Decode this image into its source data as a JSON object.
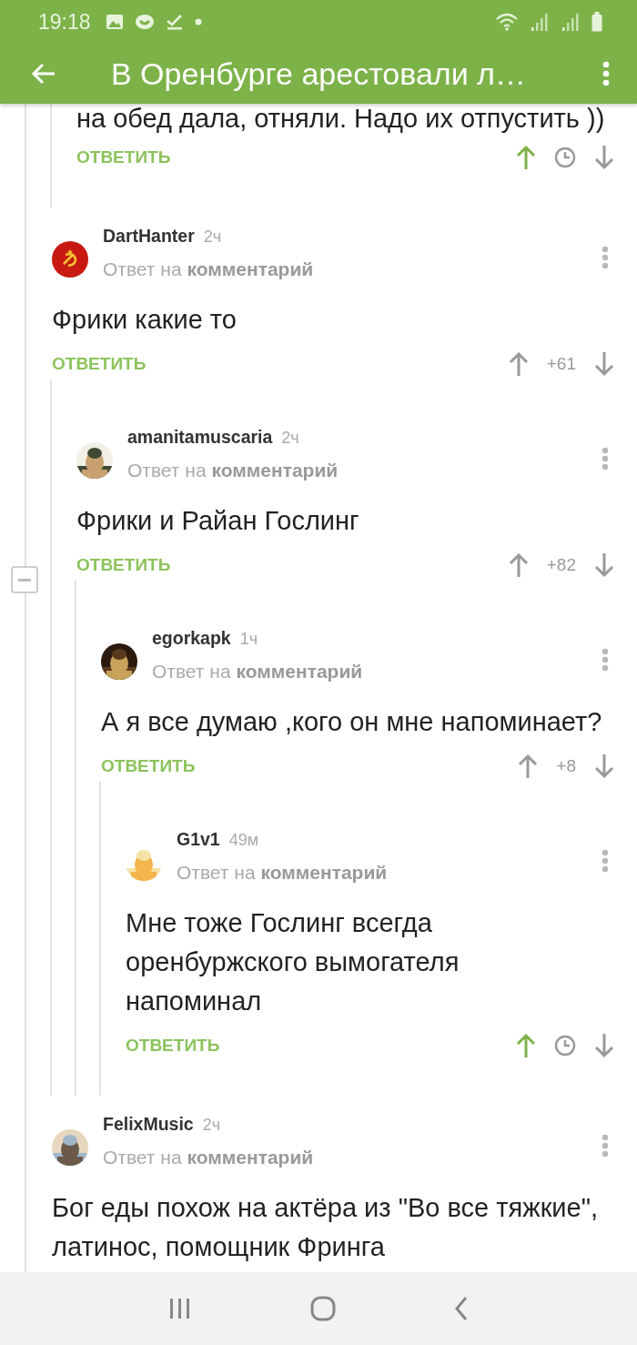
{
  "status_bar": {
    "time": "19:18"
  },
  "app_bar": {
    "title": "В Оренбурге арестовали л…"
  },
  "continued_thread": {
    "children": [
      {
        "body": "на обед дала, отняли. Надо их отпустить ))",
        "reply_label": "ОТВЕТИТЬ",
        "voted_up": true,
        "rating_hidden": true
      }
    ]
  },
  "comments": [
    {
      "author": "DartHanter",
      "time": "2ч",
      "avatar": {
        "kind": "emblem"
      },
      "context": "Ответ на **комментарий**",
      "body": "Фрики какие то",
      "reply_label": "ОТВЕТИТЬ",
      "voted_up": false,
      "rating_hidden": false,
      "rating": "+61",
      "children": [
        {
          "author": "amanitamuscaria",
          "time": "2ч",
          "avatar": {
            "kind": "picture"
          },
          "context": "Ответ на **комментарий**",
          "body": "Фрики и Райан Гослинг",
          "reply_label": "ОТВЕТИТЬ",
          "voted_up": false,
          "rating_hidden": false,
          "rating": "+82",
          "expanded": true,
          "children": [
            {
              "author": "egorkapk",
              "time": "1ч",
              "avatar": {
                "kind": "picture"
              },
              "context": "Ответ на **комментарий**",
              "body": "А я все думаю ,кого он мне напоминает?",
              "reply_label": "ОТВЕТИТЬ",
              "voted_up": false,
              "rating_hidden": false,
              "rating": "+8",
              "children": [
                {
                  "author": "G1v1",
                  "time": "49м",
                  "avatar": {
                    "kind": "picture"
                  },
                  "context": "Ответ на **комментарий**",
                  "body": "Мне тоже Гослинг всегда\nоренбуржского вымогателя\nнапоминал",
                  "reply_label": "ОТВЕТИТЬ",
                  "voted_up": true,
                  "rating_hidden": true
                }
              ]
            }
          ]
        }
      ]
    },
    {
      "author": "FelixMusic",
      "time": "2ч",
      "avatar": {
        "kind": "picture"
      },
      "context": "Ответ на **комментарий**",
      "body": "Бог еды похож на актёра из \"Во все тяжкие\",\nлатинос, помощник Фринга"
    }
  ]
}
